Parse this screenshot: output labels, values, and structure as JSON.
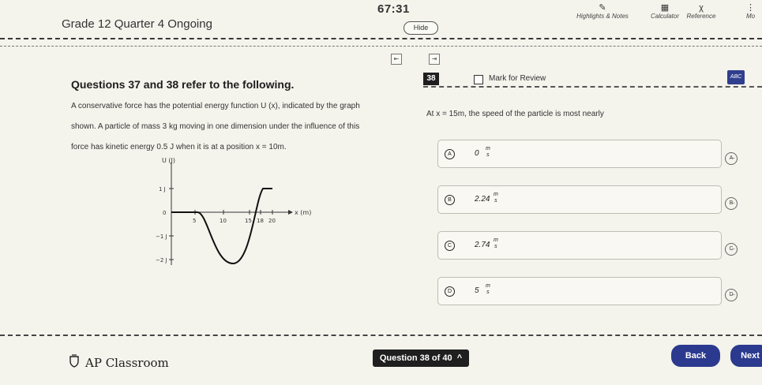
{
  "header": {
    "exam_title": "Grade 12 Quarter 4 Ongoing",
    "timer": "67:31",
    "hide_label": "Hide",
    "tools": [
      {
        "label": "Highlights & Notes",
        "icon": "highlighter-icon"
      },
      {
        "label": "Calculator",
        "icon": "calculator-icon"
      },
      {
        "label": "Reference",
        "icon": "reference-icon"
      },
      {
        "label": "Mo",
        "icon": "more-icon"
      }
    ]
  },
  "left": {
    "title": "Questions 37 and 38 refer to the following.",
    "lines": [
      "A conservative force has the potential energy function U (x), indicated by the graph",
      "shown. A particle of mass 3 kg moving in one dimension under the influence of this",
      "force has kinetic energy 0.5 J when it is at a position x = 10m."
    ],
    "graph": {
      "y_axis_label": "U (J)",
      "x_axis_label": "x (m)",
      "y_ticks": [
        "1 J",
        "0",
        "−1 J",
        "−2 J"
      ],
      "x_ticks": [
        "5",
        "10",
        "15",
        "18",
        "20"
      ]
    }
  },
  "question": {
    "number": "38",
    "mark_label": "Mark for Review",
    "badge": "ABC",
    "text": "At x = 15m, the speed of the particle is most nearly",
    "choices": [
      {
        "letter": "A",
        "value": "0",
        "unit_top": "m",
        "unit_bottom": "s"
      },
      {
        "letter": "B",
        "value": "2.24",
        "unit_top": "m",
        "unit_bottom": "s"
      },
      {
        "letter": "C",
        "value": "2.74",
        "unit_top": "m",
        "unit_bottom": "s"
      },
      {
        "letter": "D",
        "value": "5",
        "unit_top": "m",
        "unit_bottom": "s"
      }
    ]
  },
  "footer": {
    "brand": "AP Classroom",
    "nav_label": "Question 38 of 40",
    "back_label": "Back",
    "next_label": "Next"
  },
  "colors": {
    "background": "#f4f3ec",
    "accent": "#2b3a8e",
    "dark": "#1f1f1f"
  }
}
